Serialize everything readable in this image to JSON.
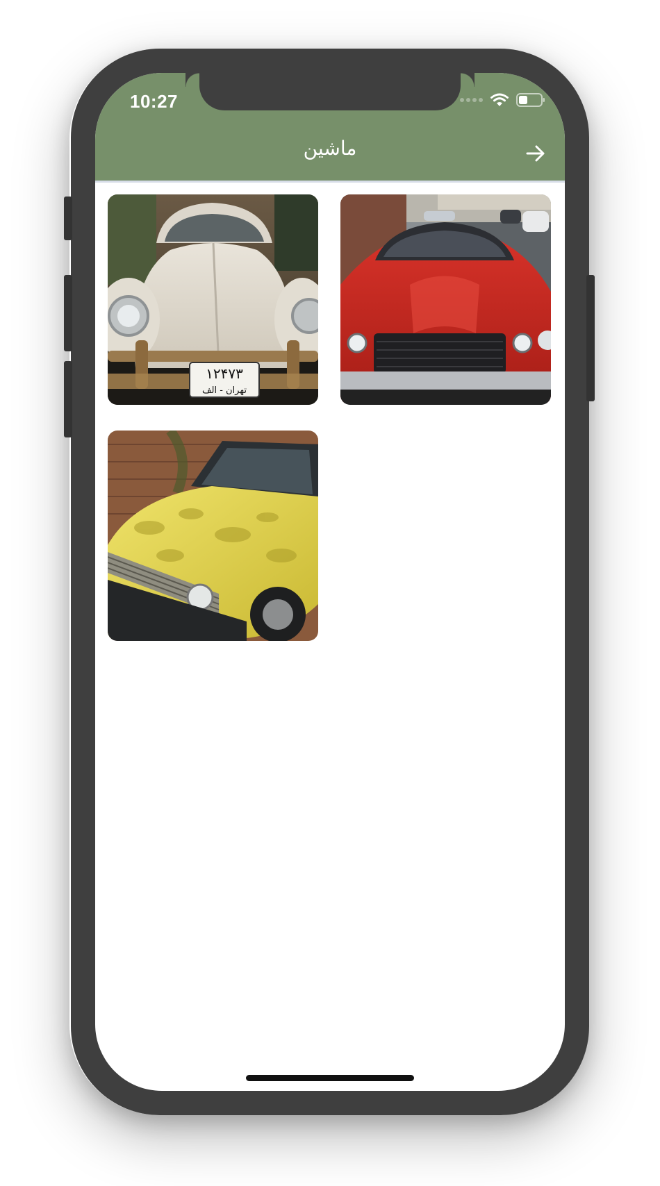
{
  "status_bar": {
    "time": "10:27"
  },
  "app_bar": {
    "title": "ماشین",
    "background_color": "#77906a",
    "back_icon": "arrow-right-icon"
  },
  "gallery": {
    "items": [
      {
        "name": "white-beetle-photo",
        "plate_line1": "۱۲۴۷۳",
        "plate_line2": "تهران - الف"
      },
      {
        "name": "red-camaro-photo"
      },
      {
        "name": "yellow-paykan-photo"
      }
    ]
  }
}
